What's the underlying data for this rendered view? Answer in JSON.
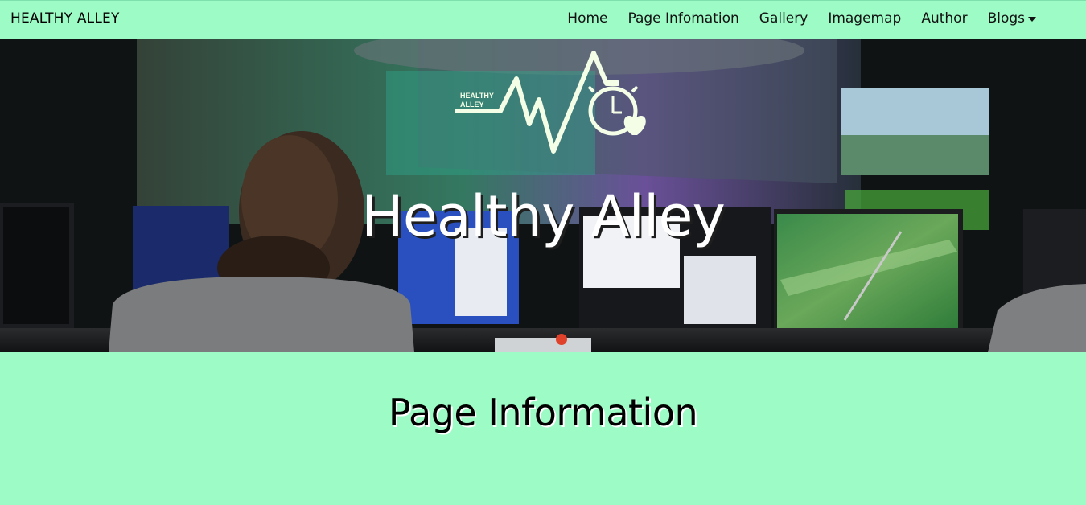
{
  "navbar": {
    "brand": "HEALTHY ALLEY",
    "links": [
      {
        "label": "Home"
      },
      {
        "label": "Page Infomation"
      },
      {
        "label": "Gallery"
      },
      {
        "label": "Imagemap"
      },
      {
        "label": "Author"
      },
      {
        "label": "Blogs",
        "dropdown": true
      }
    ]
  },
  "hero": {
    "logo_text": [
      "HEALTHY",
      "ALLEY"
    ],
    "title": "Healthy Alley"
  },
  "main": {
    "section_title": "Page Information"
  },
  "colors": {
    "background": "#9dfcc6",
    "logo": "#f4fde6"
  },
  "icons": [
    "heartbeat-logo-icon",
    "stopwatch-icon",
    "heart-icon",
    "chevron-down-icon"
  ]
}
